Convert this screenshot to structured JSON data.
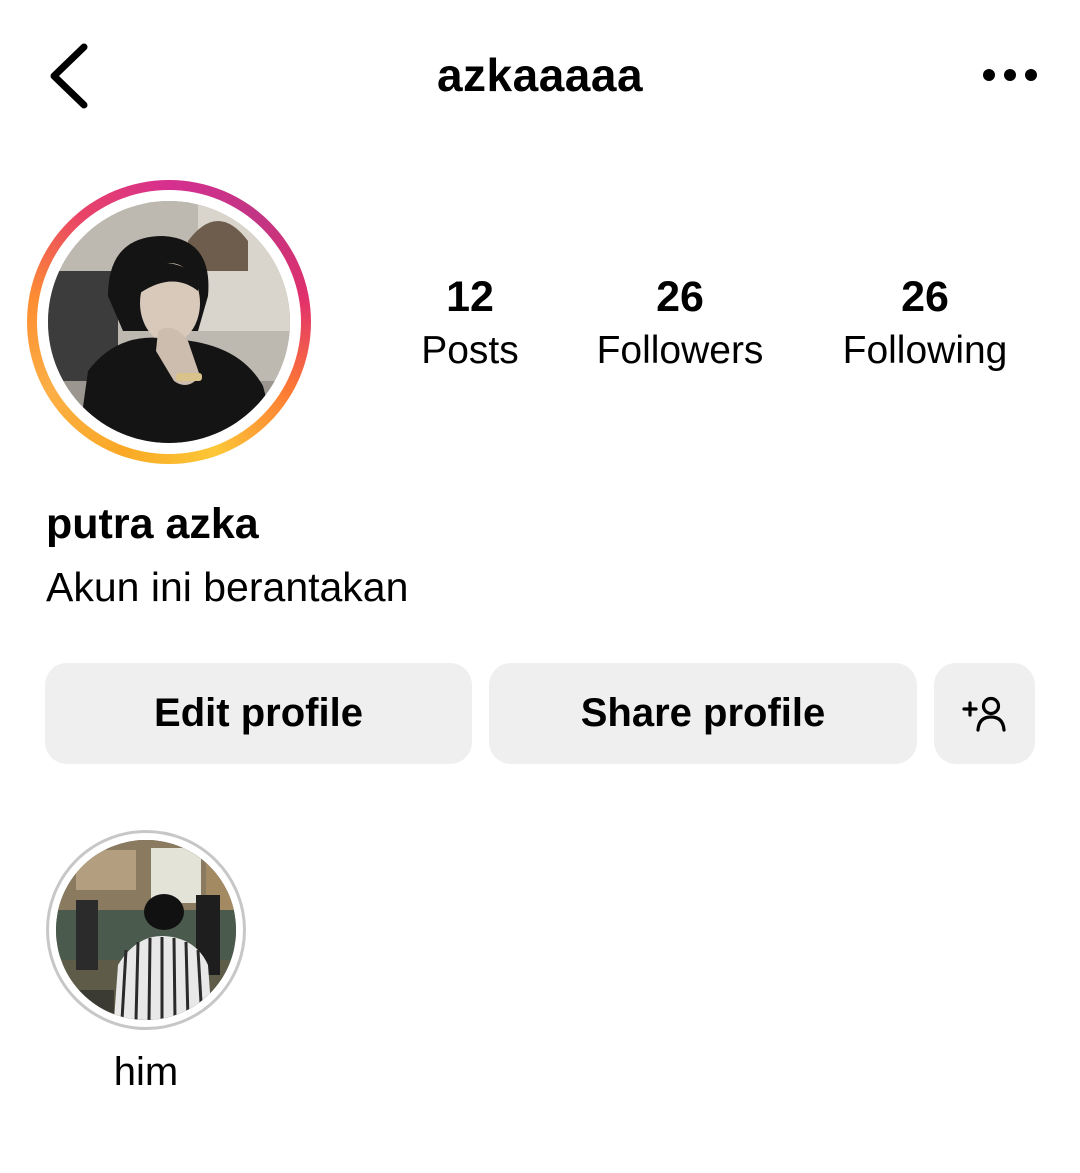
{
  "header": {
    "username": "azkaaaaa",
    "back_icon": "chevron-left-icon",
    "more_icon": "ellipsis-horizontal-icon"
  },
  "profile": {
    "avatar": "profile-photo",
    "has_story_ring": true,
    "display_name": "putra azka",
    "bio": "Akun ini berantakan"
  },
  "stats": {
    "posts": {
      "value": "12",
      "label": "Posts"
    },
    "followers": {
      "value": "26",
      "label": "Followers"
    },
    "following": {
      "value": "26",
      "label": "Following"
    }
  },
  "actions": {
    "edit_label": "Edit profile",
    "share_label": "Share profile",
    "discover_icon": "add-person-icon"
  },
  "highlights": [
    {
      "label": "him",
      "cover": "highlight-photo"
    }
  ],
  "colors": {
    "button_bg": "#efefef",
    "ring_gradient": [
      "#fcc737",
      "#fd7a34",
      "#e1306c",
      "#c13584"
    ],
    "highlight_ring": "#c7c7c7"
  }
}
